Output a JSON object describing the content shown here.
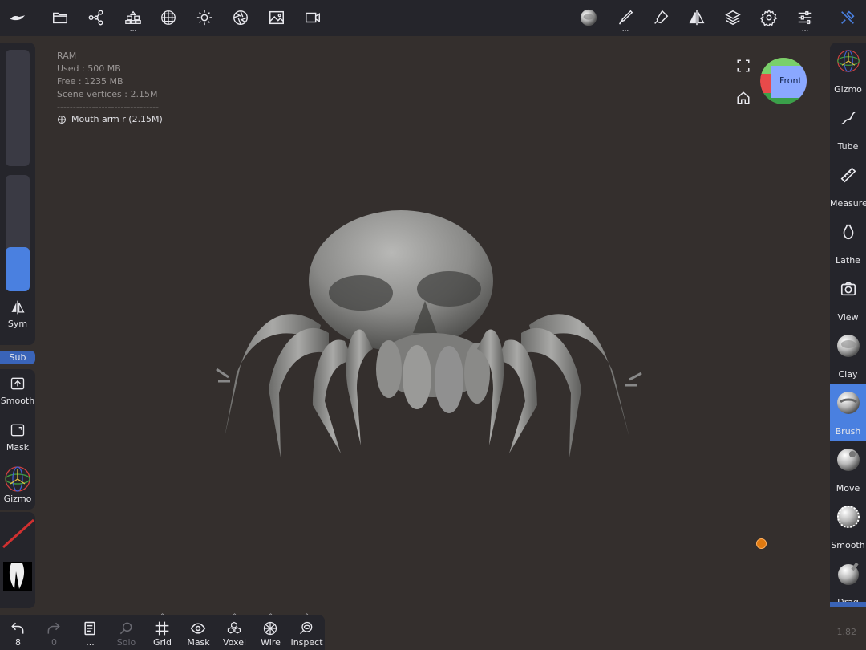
{
  "toolbar_right": {
    "labels": []
  },
  "hud": {
    "ram_label": "RAM",
    "used": "Used : 500 MB",
    "free": "Free : 1235 MB",
    "vertices": "Scene vertices : 2.15M",
    "divider": "--------------------------------",
    "object_name": "Mouth arm r (2.15M)"
  },
  "left_panel": {
    "sym_label": "Sym",
    "sub_label": "Sub",
    "smooth_label": "Smooth",
    "mask_label": "Mask",
    "gizmo_label": "Gizmo",
    "brush_slider_level": 0.38
  },
  "right_panel": {
    "items": [
      {
        "label": "Gizmo"
      },
      {
        "label": "Tube"
      },
      {
        "label": "Measure"
      },
      {
        "label": "Lathe"
      },
      {
        "label": "View"
      },
      {
        "label": "Clay"
      },
      {
        "label": "Brush"
      },
      {
        "label": "Move"
      },
      {
        "label": "Smooth"
      },
      {
        "label": "Drag"
      }
    ],
    "active": "Brush"
  },
  "viewcube": {
    "label": "Front"
  },
  "bottom_bar": {
    "undo_count": "8",
    "redo_count": "0",
    "more_label": "...",
    "solo_label": "Solo",
    "grid_label": "Grid",
    "mask_label": "Mask",
    "voxel_label": "Voxel",
    "wire_label": "Wire",
    "inspect_label": "Inspect"
  },
  "version": "1.82",
  "colors": {
    "accent": "#4a80e0",
    "toolbar_bg": "#25252b",
    "viewport_bg": "#342f2d"
  }
}
